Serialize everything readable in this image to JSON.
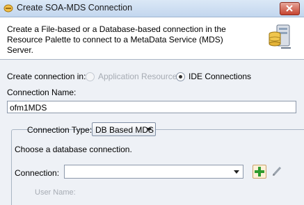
{
  "window": {
    "title": "Create SOA-MDS Connection",
    "icon": "oracle-connection-icon",
    "close_icon": "close-icon"
  },
  "header": {
    "description": "Create a File-based or a Database-based connection in the Resource Palette to connect to a MetaData Service (MDS) Server.",
    "icon": "database-server-icon"
  },
  "form": {
    "create_in_label": "Create connection in:",
    "create_in_options": [
      {
        "label": "Application Resources",
        "selected": false,
        "enabled": false
      },
      {
        "label": "IDE Connections",
        "selected": true,
        "enabled": true
      }
    ],
    "connection_name_label": "Connection Name:",
    "connection_name_value": "ofm1MDS",
    "connection_type_label": "Connection Type:",
    "connection_type_value": "DB Based MDS",
    "choose_db_text": "Choose a database connection.",
    "connection_label": "Connection:",
    "connection_value": "",
    "add_icon": "plus-icon",
    "edit_icon": "pencil-icon",
    "user_name_label": "User Name:"
  },
  "colors": {
    "accent": "#3a6ea5",
    "close_red": "#c5432f",
    "add_green": "#2e9b2e"
  }
}
